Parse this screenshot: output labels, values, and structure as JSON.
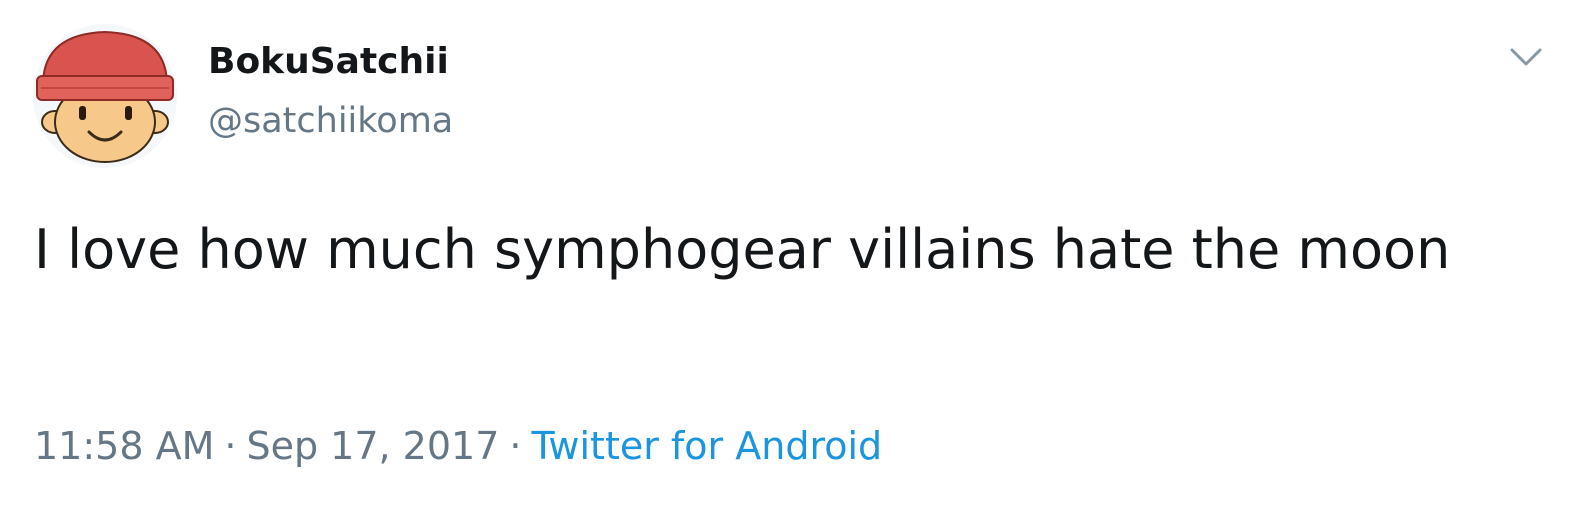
{
  "user": {
    "display_name": "BokuSatchii",
    "handle": "@satchiikoma",
    "avatar_icon": "cartoon-face-red-beanie-avatar"
  },
  "tweet": {
    "text": "I love how much symphogear villains hate the moon",
    "time": "11:58 AM",
    "separator": "·",
    "date": "Sep 17, 2017",
    "source": "Twitter for Android"
  },
  "icons": {
    "menu": "chevron-down-icon"
  },
  "colors": {
    "text_primary": "#14171a",
    "text_secondary": "#657786",
    "link": "#1b95e0",
    "beanie_red": "#d9534f",
    "face_skin": "#f6c98a"
  }
}
